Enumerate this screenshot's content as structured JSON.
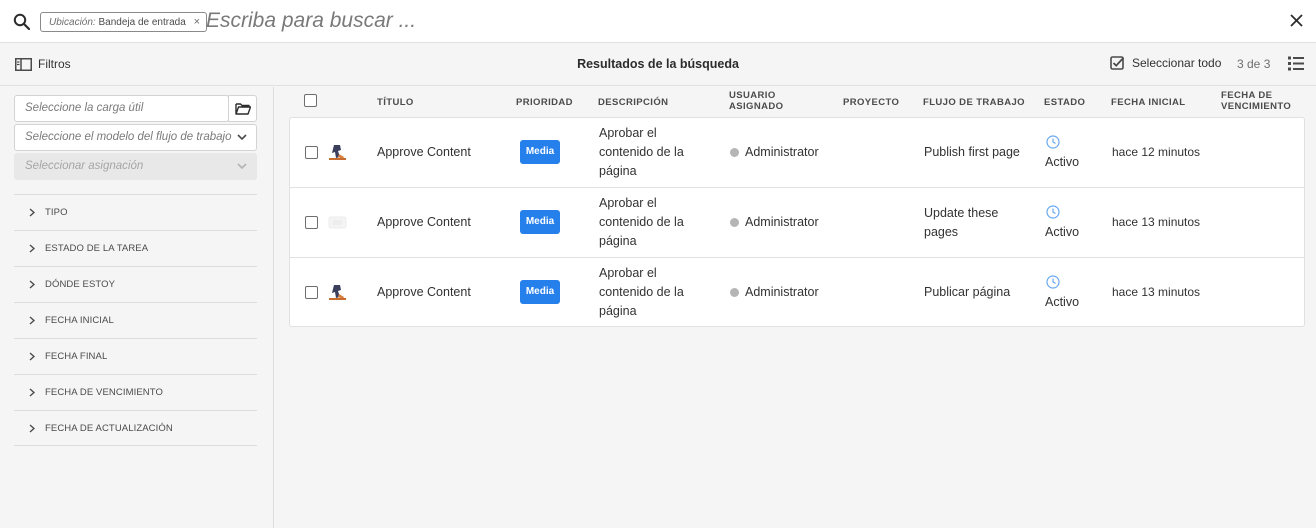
{
  "search": {
    "tag_key": "Ubicación:",
    "tag_value": "Bandeja de entrada",
    "tag_remove": "×",
    "placeholder": "Escriba para buscar ..."
  },
  "toolbar": {
    "filters_label": "Filtros",
    "title": "Resultados de la búsqueda",
    "select_all_label": "Seleccionar todo",
    "count": "3 de 3"
  },
  "sidebar": {
    "payload_placeholder": "Seleccione la carga útil",
    "model_placeholder": "Seleccione el modelo del flujo de trabajo",
    "assign_placeholder": "Seleccionar asignación",
    "facets": [
      {
        "label": "TIPO"
      },
      {
        "label": "ESTADO DE LA TAREA"
      },
      {
        "label": "DÓNDE ESTOY"
      },
      {
        "label": "FECHA INICIAL"
      },
      {
        "label": "FECHA FINAL"
      },
      {
        "label": "FECHA DE VENCIMIENTO"
      },
      {
        "label": "FECHA DE ACTUALIZACIÓN"
      }
    ]
  },
  "table": {
    "headers": {
      "title": "TÍTULO",
      "priority": "PRIORIDAD",
      "description": "DESCRIPCIÓN",
      "assignee_1": "USUARIO",
      "assignee_2": "ASIGNADO",
      "project": "PROYECTO",
      "workflow": "FLUJO DE TRABAJO",
      "status": "ESTADO",
      "start_date": "FECHA INICIAL",
      "due_1": "FECHA DE",
      "due_2": "VENCIMIENTO"
    },
    "rows": [
      {
        "title": "Approve Content",
        "priority": "Media",
        "desc_1": "Aprobar el",
        "desc_2": "contenido de la",
        "desc_3": "página",
        "assignee": "Administrator",
        "workflow_1": "Publish first page",
        "workflow_2": "",
        "status": "Activo",
        "start": "hace 12 minutos",
        "thumb_icon": "page-thumbnail"
      },
      {
        "title": "Approve Content",
        "priority": "Media",
        "desc_1": "Aprobar el",
        "desc_2": "contenido de la",
        "desc_3": "página",
        "assignee": "Administrator",
        "workflow_1": "Update these",
        "workflow_2": "pages",
        "status": "Activo",
        "start": "hace 13 minutos",
        "thumb_icon": "empty-thumbnail"
      },
      {
        "title": "Approve Content",
        "priority": "Media",
        "desc_1": "Aprobar el",
        "desc_2": "contenido de la",
        "desc_3": "página",
        "assignee": "Administrator",
        "workflow_1": "Publicar página",
        "workflow_2": "",
        "status": "Activo",
        "start": "hace 13 minutos",
        "thumb_icon": "page-thumbnail"
      }
    ]
  },
  "colors": {
    "accent": "#2680eb",
    "priority_badge": "#2680eb",
    "status_icon": "#6aa8ef"
  }
}
